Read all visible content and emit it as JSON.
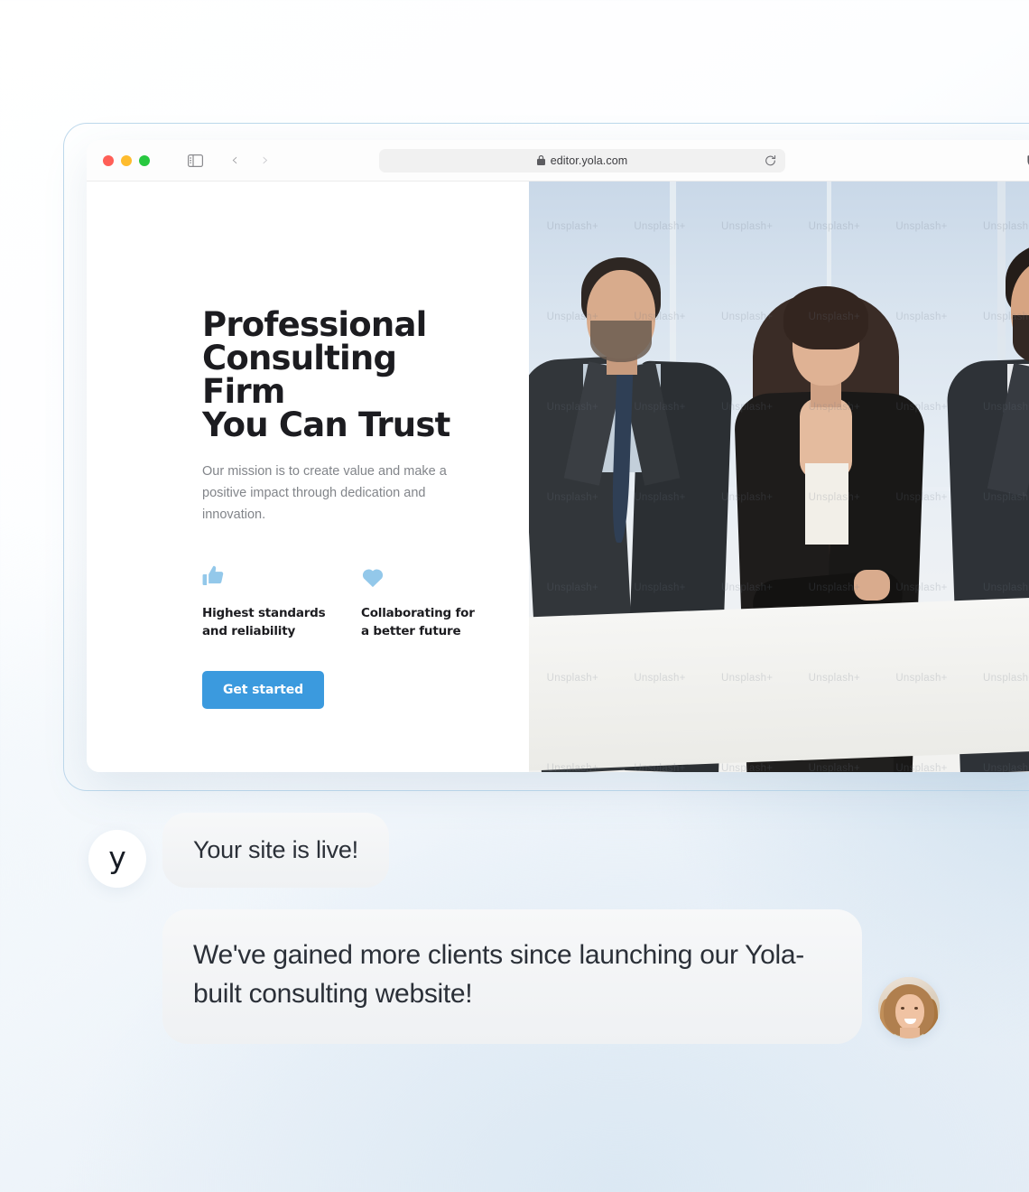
{
  "browser": {
    "traffic_lights": [
      "close",
      "minimize",
      "zoom"
    ],
    "sidebar_icon": "sidebar-toggle-icon",
    "back_label": "‹",
    "forward_label": "›",
    "shield_icon": "privacy-shield-icon",
    "lock_icon": "lock-icon",
    "url": "editor.yola.com",
    "reload_icon": "reload-icon"
  },
  "site": {
    "hero": {
      "title": "Professional\nConsulting Firm\nYou Can Trust",
      "subtitle": "Our mission is to create value and make a positive impact through dedication and innovation.",
      "cta_label": "Get started"
    },
    "features": [
      {
        "icon": "thumbs-up-icon",
        "label": "Highest standards\nand reliability"
      },
      {
        "icon": "heart-icon",
        "label": "Collaborating for\na better future"
      }
    ],
    "photo": {
      "alt": "three business professionals in suits standing by office window",
      "watermark": "Unsplash+"
    }
  },
  "chat": {
    "messages": [
      {
        "avatar": "yola-logo-avatar",
        "avatar_glyph": "y",
        "text": "Your site is live!"
      },
      {
        "avatar": "customer-photo-avatar",
        "text": "We've gained more clients since launching our Yola-built consulting website!"
      }
    ]
  },
  "colors": {
    "cta_blue": "#3b9ade",
    "feature_icon_blue": "#93c8ea",
    "bubble_gray": "#f2f4f6",
    "text_dark": "#1c1c20",
    "text_muted": "#82858a",
    "frame_border": "#bed9ec"
  }
}
